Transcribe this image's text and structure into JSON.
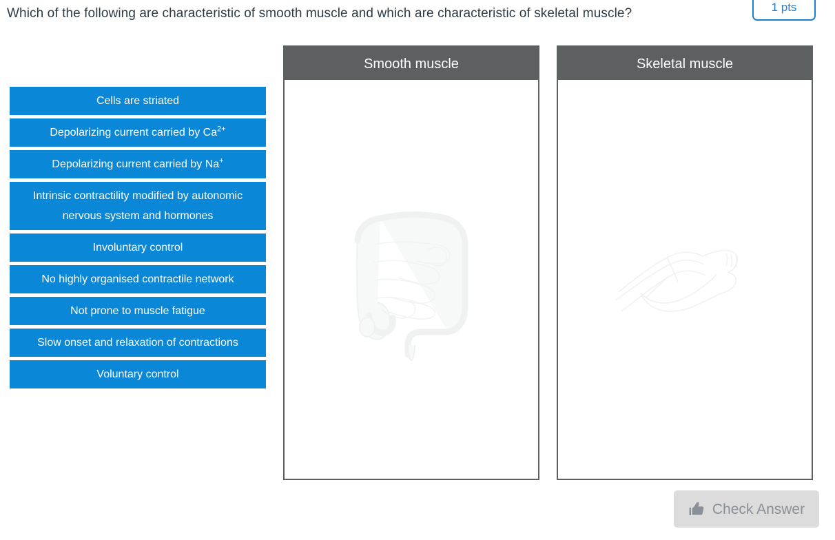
{
  "question": {
    "text": "Which of the following are characteristic of smooth muscle and which are characteristic of skeletal muscle?",
    "points_badge": "1 pts"
  },
  "options": [
    {
      "label": "Cells are striated",
      "html": "Cells are striated"
    },
    {
      "label": "Depolarizing current carried by Ca2+",
      "html": "Depolarizing current carried by Ca<sup>2+</sup>"
    },
    {
      "label": "Depolarizing current carried by Na+",
      "html": "Depolarizing current carried by Na<sup>+</sup>"
    },
    {
      "label": "Intrinsic contractility modified by autonomic nervous system and hormones",
      "html": "Intrinsic contractility modified by autonomic nervous system and hormones"
    },
    {
      "label": "Involuntary control",
      "html": "Involuntary control"
    },
    {
      "label": "No highly organised contractile network",
      "html": "No highly organised contractile network"
    },
    {
      "label": "Not prone to muscle fatigue",
      "html": "Not prone to muscle fatigue"
    },
    {
      "label": "Slow onset and relaxation of contractions",
      "html": "Slow onset and relaxation of contractions"
    },
    {
      "label": "Voluntary control",
      "html": "Voluntary control"
    }
  ],
  "dropzones": [
    {
      "title": "Smooth muscle",
      "art_icon": "intestine-illustration",
      "dropped_items": []
    },
    {
      "title": "Skeletal muscle",
      "art_icon": "flexed-arm-illustration",
      "dropped_items": []
    }
  ],
  "footer": {
    "check_answer_label": "Check Answer",
    "check_answer_icon": "thumbs-up-icon"
  },
  "colors": {
    "option_blue": "#0a87d6",
    "dropzone_grey": "#5d6061",
    "badge_blue": "#1b7fd0",
    "button_grey": "#dcdcdc",
    "button_text_grey": "#8a9097",
    "question_text": "#2d3b45"
  }
}
